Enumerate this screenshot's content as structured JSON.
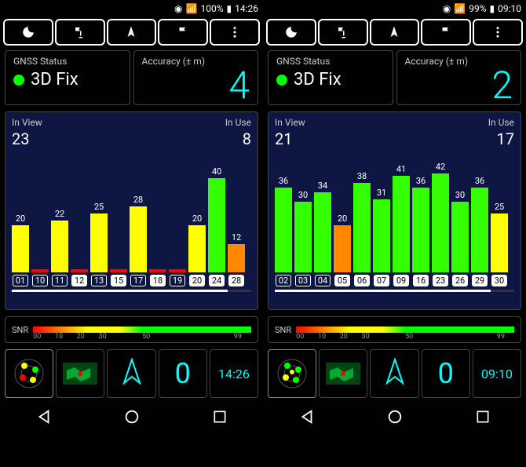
{
  "screens": [
    {
      "status": {
        "battery": "100%",
        "time": "14:26"
      },
      "gnss": {
        "title": "GNSS Status",
        "fix": "3D Fix"
      },
      "accuracy": {
        "title": "Accuracy (± m)",
        "value": "4"
      },
      "chart": {
        "in_view_label": "In View",
        "in_view": "23",
        "in_use_label": "In Use",
        "in_use": "8"
      },
      "snr": {
        "label": "SNR",
        "ticks": [
          "00",
          "10",
          "20",
          "30",
          "50",
          "99"
        ]
      },
      "tab_zero": "0",
      "tab_time": "14:26"
    },
    {
      "status": {
        "battery": "99%",
        "time": "09:10"
      },
      "gnss": {
        "title": "GNSS Status",
        "fix": "3D Fix"
      },
      "accuracy": {
        "title": "Accuracy (± m)",
        "value": "2"
      },
      "chart": {
        "in_view_label": "In View",
        "in_view": "21",
        "in_use_label": "In Use",
        "in_use": "17"
      },
      "snr": {
        "label": "SNR",
        "ticks": [
          "00",
          "10",
          "20",
          "30",
          "50",
          "99"
        ]
      },
      "tab_zero": "0",
      "tab_time": "09:10"
    }
  ],
  "chart_data": [
    {
      "type": "bar",
      "title": "Satellite SNR",
      "ylabel": "SNR",
      "ylim": [
        0,
        50
      ],
      "categories": [
        "01",
        "10",
        "11",
        "12",
        "13",
        "15",
        "17",
        "18",
        "19",
        "20",
        "24",
        "28"
      ],
      "values": [
        20,
        0,
        22,
        0,
        25,
        0,
        28,
        0,
        0,
        20,
        40,
        12
      ],
      "in_use": [
        false,
        false,
        false,
        true,
        false,
        true,
        false,
        true,
        false,
        true,
        true,
        true
      ],
      "colors": [
        "yellow",
        "red",
        "yellow",
        "red",
        "yellow",
        "red",
        "yellow",
        "red",
        "red",
        "yellow",
        "green",
        "orange"
      ]
    },
    {
      "type": "bar",
      "title": "Satellite SNR",
      "ylabel": "SNR",
      "ylim": [
        0,
        50
      ],
      "categories": [
        "02",
        "03",
        "04",
        "05",
        "06",
        "07",
        "09",
        "16",
        "23",
        "26",
        "29",
        "30"
      ],
      "values": [
        36,
        30,
        34,
        20,
        38,
        31,
        41,
        36,
        42,
        30,
        36,
        25
      ],
      "in_use": [
        false,
        false,
        false,
        true,
        true,
        true,
        true,
        true,
        true,
        true,
        true,
        true
      ],
      "colors": [
        "green",
        "green",
        "green",
        "orange",
        "green",
        "green",
        "green",
        "green",
        "green",
        "green",
        "green",
        "yellow"
      ]
    }
  ]
}
